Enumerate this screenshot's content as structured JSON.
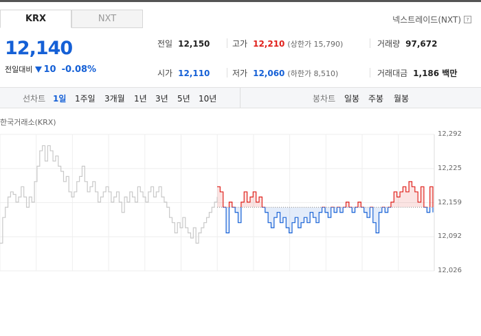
{
  "tabs": [
    {
      "label": "KRX",
      "active": true
    },
    {
      "label": "NXT",
      "active": false
    }
  ],
  "nxt_link": "넥스트레이드(NXT)",
  "help_glyph": "?",
  "price": {
    "current": "12,140",
    "change_label": "전일대비",
    "change_amount": "10",
    "change_pct": "-0.08%",
    "direction": "down"
  },
  "info": {
    "prev": {
      "label": "전일",
      "value": "12,150"
    },
    "high": {
      "label": "고가",
      "value": "12,210",
      "sub": "(상한가 15,790)"
    },
    "volume": {
      "label": "거래량",
      "value": "97,672"
    },
    "open": {
      "label": "시가",
      "value": "12,110"
    },
    "low": {
      "label": "저가",
      "value": "12,060",
      "sub": "(하한가 8,510)"
    },
    "amount": {
      "label": "거래대금",
      "value": "1,186 백만"
    }
  },
  "line_bar": {
    "heading": "선차트",
    "items": [
      "1일",
      "1주일",
      "3개월",
      "1년",
      "3년",
      "5년",
      "10년"
    ],
    "selected": "1일"
  },
  "candle_bar": {
    "heading": "봉차트",
    "items": [
      "일봉",
      "주봉",
      "월봉"
    ]
  },
  "colors": {
    "up": "#e0201b",
    "down": "#1560d6",
    "grey": "#c8c8c8",
    "accent": "#1560d6"
  },
  "chart_data": {
    "type": "line",
    "source_label": "한국거래소(KRX)",
    "y_ticks": [
      "12,292",
      "12,225",
      "12,159",
      "12,092",
      "12,026"
    ],
    "ylim": [
      12026,
      12292
    ],
    "baseline": 12150,
    "grid": true,
    "series": [
      {
        "values": [
          12080,
          12130,
          12150,
          12170,
          12180,
          12175,
          12160,
          12170,
          12190,
          12170,
          12150,
          12170,
          12160,
          12200,
          12230,
          12260,
          12270,
          12240,
          12270,
          12260,
          12240,
          12250,
          12230,
          12220,
          12200,
          12210,
          12180,
          12170,
          12180,
          12200,
          12210,
          12230,
          12200,
          12180,
          12190,
          12200,
          12180,
          12160,
          12170,
          12180,
          12190,
          12180,
          12160,
          12170,
          12180,
          12160,
          12140,
          12170,
          12160,
          12180,
          12170,
          12160,
          12190,
          12180,
          12170,
          12160,
          12180,
          12190,
          12170,
          12180,
          12190,
          12170,
          12160,
          12150,
          12130,
          12120,
          12100,
          12120,
          12110,
          12130,
          12110,
          12100,
          12090,
          12110,
          12080,
          12100,
          12110,
          12120,
          12130,
          12140,
          12150,
          12160,
          12170
        ]
      },
      {
        "values": [
          12190,
          12180,
          12150,
          12100,
          12160,
          12150,
          12140,
          12120,
          12160,
          12180,
          12160,
          12170,
          12180,
          12160,
          12170,
          12150,
          12140,
          12120,
          12110,
          12130,
          12140,
          12120,
          12130,
          12110,
          12100,
          12120,
          12130,
          12110,
          12120,
          12130,
          12120,
          12140,
          12130,
          12120,
          12140,
          12150,
          12140,
          12130,
          12150,
          12140,
          12150,
          12140,
          12150,
          12160,
          12150,
          12140,
          12150,
          12160,
          12150,
          12140,
          12130,
          12150,
          12120,
          12100,
          12140,
          12150,
          12140,
          12150,
          12160,
          12180,
          12170,
          12180,
          12190,
          12180,
          12200,
          12190,
          12180,
          12160,
          12190,
          12150,
          12140,
          12190,
          12140
        ]
      }
    ]
  }
}
